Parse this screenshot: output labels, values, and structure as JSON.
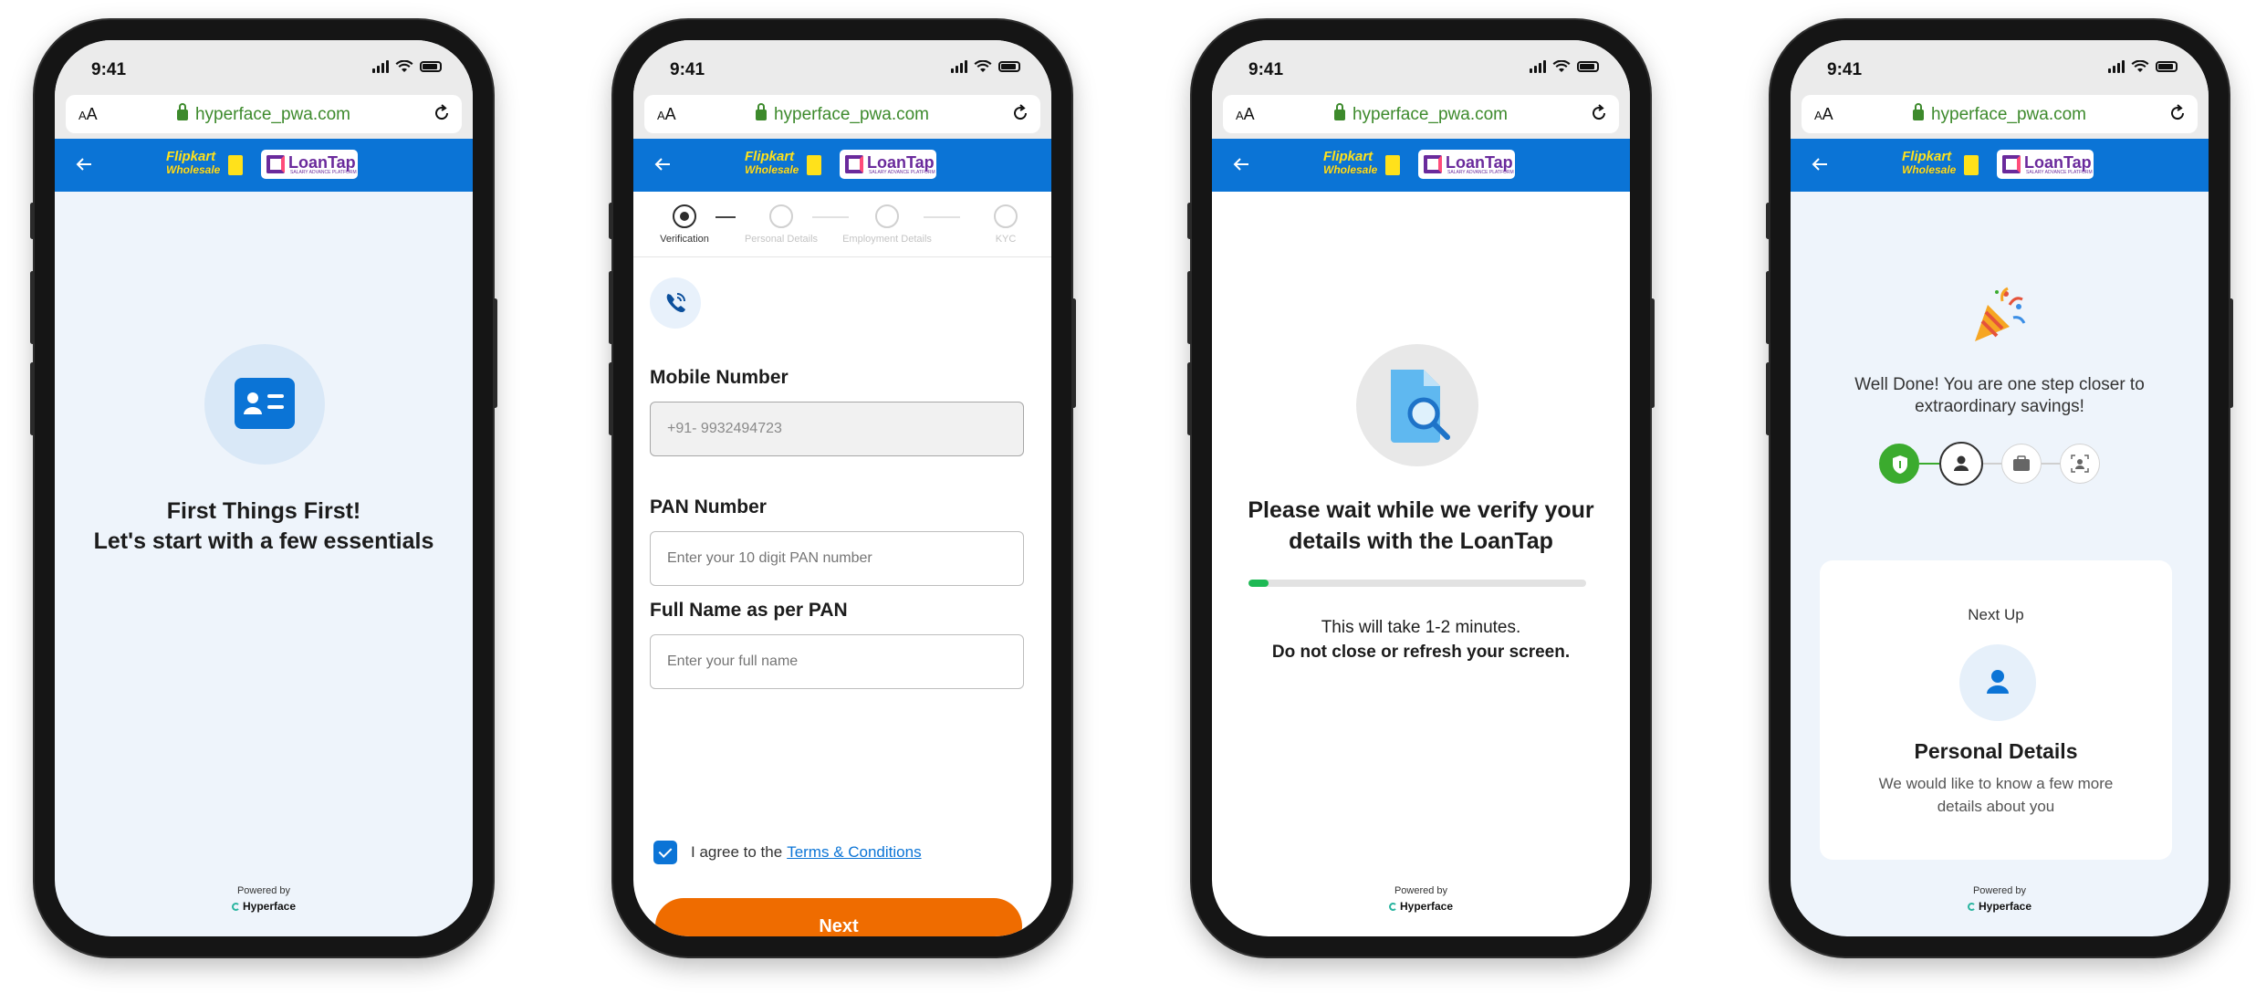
{
  "status": {
    "time": "9:41"
  },
  "browser": {
    "text_size_label": "AA",
    "url": "hyperface_pwa.com"
  },
  "brand": {
    "flipkart_line1": "Flipkart",
    "flipkart_line2": "Wholesale",
    "loantap": "LoanTap",
    "loantap_tagline": "SALARY ADVANCE PLATFORM",
    "blue": "#0b74d6",
    "orange": "#ef6c00",
    "green": "#3bab2e"
  },
  "footer": {
    "powered_by": "Powered by",
    "brand": "Hyperface"
  },
  "screen1": {
    "icon": "id-card-icon",
    "title_line1": "First Things First!",
    "title_line2": "Let's start with a few essentials"
  },
  "screen2": {
    "steps": [
      {
        "label": "Verification",
        "icon": "shield-icon",
        "active": true
      },
      {
        "label": "Personal Details",
        "icon": "user-icon",
        "active": false
      },
      {
        "label": "Employment Details",
        "icon": "briefcase-icon",
        "active": false
      },
      {
        "label": "KYC",
        "icon": "scan-face-icon",
        "active": false
      }
    ],
    "section_icon": "phone-call-icon",
    "mobile_label": "Mobile Number",
    "mobile_value": "+91- 9932494723",
    "pan_label": "PAN Number",
    "pan_placeholder": "Enter your 10 digit PAN number",
    "name_label": "Full Name as per PAN",
    "name_placeholder": "Enter your full name",
    "agree_text": "I agree to the",
    "terms_link": "Terms & Conditions",
    "agree_checked": true,
    "next_label": "Next"
  },
  "screen3": {
    "icon": "document-search-icon",
    "title_line1": "Please wait while we verify your",
    "title_line2": "details with the LoanTap",
    "progress": 0.06,
    "note_line1": "This will take 1-2 minutes.",
    "note_line2": "Do not close or refresh your screen."
  },
  "screen4": {
    "icon": "party-popper-icon",
    "title_line1": "Well Done! You are one step closer to",
    "title_line2": "extraordinary savings!",
    "steps": [
      {
        "icon": "shield-icon",
        "state": "done"
      },
      {
        "icon": "user-icon",
        "state": "current"
      },
      {
        "icon": "briefcase-icon",
        "state": "pending"
      },
      {
        "icon": "scan-face-icon",
        "state": "pending"
      }
    ],
    "next_up_label": "Next Up",
    "card_icon": "user-icon",
    "card_title": "Personal Details",
    "card_desc": "We would like to know a few more details about you"
  }
}
